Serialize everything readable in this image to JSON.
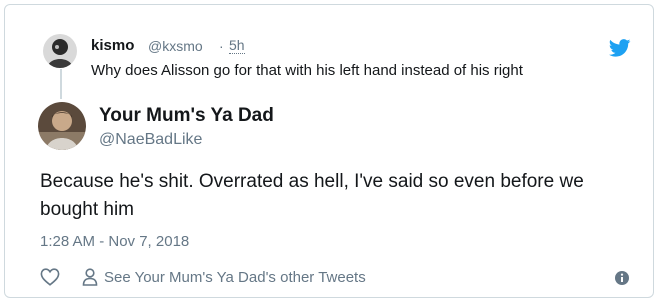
{
  "reply": {
    "display_name": "kismo",
    "handle": "@kxsmo",
    "separator": "·",
    "time": "5h",
    "text": "Why does Alisson go for that with his left hand instead of his right"
  },
  "tweet": {
    "display_name": "Your Mum's Ya Dad",
    "handle": "@NaeBadLike",
    "text": "Because he's shit. Overrated as hell, I've said so even before we bought him",
    "timestamp": "1:28 AM - Nov 7, 2018"
  },
  "actions": {
    "other_tweets_label": "See Your Mum's Ya Dad's other Tweets"
  },
  "icons": {
    "brand": "twitter-bird-icon",
    "like": "heart-icon",
    "profile": "person-icon",
    "info": "info-icon"
  },
  "colors": {
    "brand_blue": "#1da1f2",
    "secondary_text": "#657786",
    "primary_text": "#14171a",
    "border": "#cfd9de"
  }
}
